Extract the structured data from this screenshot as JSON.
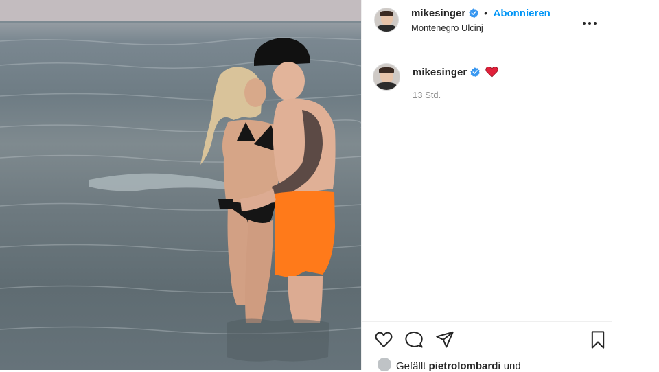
{
  "post": {
    "username": "mikesinger",
    "follow_label": "Abonnieren",
    "separator": "•",
    "location": "Montenegro Ulcinj",
    "caption_emoji": "❤️",
    "time_ago": "13 Std.",
    "likes_prefix": "Gefällt",
    "likes_user": "pietrolombardi",
    "likes_suffix": "und"
  },
  "icons": {
    "verified": "verified-badge-icon",
    "more": "more-options-icon",
    "like": "heart-icon",
    "comment": "comment-icon",
    "share": "paper-plane-icon",
    "save": "bookmark-icon"
  },
  "colors": {
    "link_blue": "#0095f6",
    "verified_blue": "#3897f0",
    "heart_red": "#e0203a",
    "swim_trunks": "#ff7a1a"
  }
}
